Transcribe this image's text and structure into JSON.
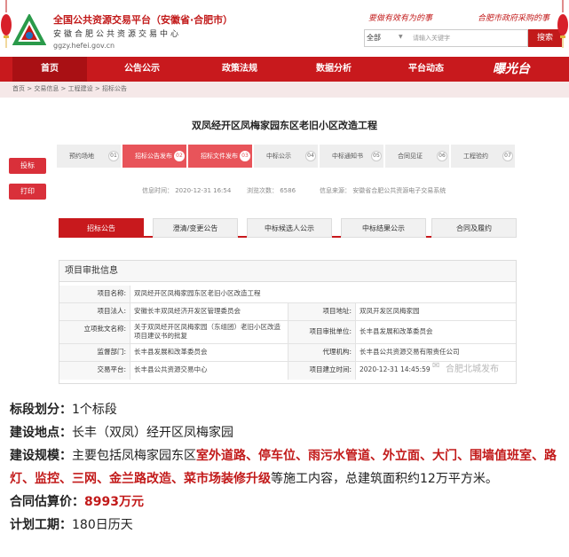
{
  "header": {
    "site_title": "全国公共资源交易平台（安徽省·合肥市）",
    "site_sub": "安徽合肥公共资源交易中心",
    "site_url": "ggzy.hefei.gov.cn",
    "slogan_left": "要做有效有为的事",
    "slogan_right": "合肥市政府采购的事",
    "search_select": "全部",
    "search_placeholder": "请输入关键字",
    "search_button": "搜索"
  },
  "nav": {
    "items": [
      "首页",
      "公告公示",
      "政策法规",
      "数据分析",
      "平台动态"
    ],
    "logo_text": "曝光台"
  },
  "breadcrumb": "首页 > 交易信息 > 工程建设 > 招标公告",
  "side": {
    "print": "投标",
    "share": "打印"
  },
  "content": {
    "title": "双凤经开区凤梅家园东区老旧小区改造工程",
    "steps": [
      {
        "label": "预约场地",
        "num": "01"
      },
      {
        "label": "招标公告发布",
        "num": "02"
      },
      {
        "label": "招标文件发布",
        "num": "03"
      },
      {
        "label": "中标公示",
        "num": "04"
      },
      {
        "label": "中标通知书",
        "num": "05"
      },
      {
        "label": "合同见证",
        "num": "06"
      },
      {
        "label": "工程验约",
        "num": "07"
      }
    ],
    "meta_time": "信息时间：  2020-12-31 16:54",
    "meta_views": "浏览次数：  6586",
    "meta_source": "信息来源：  安徽省合肥公共资源电子交易系统",
    "tabs": [
      "招标公告",
      "澄清/变更公告",
      "中标候选人公示",
      "中标结果公示",
      "合同及履约"
    ]
  },
  "info": {
    "head": "项目审批信息",
    "rows": [
      {
        "l1": "项目名称:",
        "v1": "双凤经开区凤梅家园东区老旧小区改造工程",
        "l2": "",
        "v2": ""
      },
      {
        "l1": "项目法人:",
        "v1": "安徽长丰双凤经济开发区管理委员会",
        "l2": "项目地址:",
        "v2": "双凤开发区凤梅家园"
      },
      {
        "l1": "立项批文名称:",
        "v1": "关于双凤经开区凤梅家园（东组团）老旧小区改造项目建议书的批复",
        "l2": "项目审批单位:",
        "v2": "长丰县发展和改革委员会"
      },
      {
        "l1": "监督部门:",
        "v1": "长丰县发展和改革委员会",
        "l2": "代理机构:",
        "v2": "长丰县公共资源交易有限责任公司"
      },
      {
        "l1": "交易平台:",
        "v1": "长丰县公共资源交易中心",
        "l2": "项目建立时间:",
        "v2": "2020-12-31 14:45:59"
      }
    ]
  },
  "watermark": "合肥北城发布",
  "article": {
    "line1_label": "标段划分：",
    "line1_value": "1个标段",
    "line2_label": "建设地点：",
    "line2_value": "长丰（双凤）经开区凤梅家园",
    "line3_label": "建设规模：",
    "line3_prefix": "主要包括凤梅家园东区",
    "line3_red": "室外道路、停车位、雨污水管道、外立面、大门、围墙值班室、路灯、监控、三网、金兰路改造、菜市场装修升级",
    "line3_suffix": "等施工内容，总建筑面积约12万平方米。",
    "line4_label": "合同估算价：",
    "line4_value": "8993万元",
    "line5_label": "计划工期：",
    "line5_value": "180日历天"
  }
}
